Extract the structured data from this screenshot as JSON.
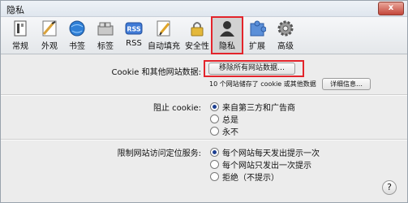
{
  "window": {
    "title": "隐私",
    "close_glyph": "x"
  },
  "toolbar": {
    "items": [
      {
        "label": "常规",
        "icon": "general-icon"
      },
      {
        "label": "外观",
        "icon": "appearance-icon"
      },
      {
        "label": "书签",
        "icon": "bookmarks-globe-icon"
      },
      {
        "label": "标签",
        "icon": "tabs-icon"
      },
      {
        "label": "RSS",
        "icon": "rss-icon",
        "text": "RSS"
      },
      {
        "label": "自动填充",
        "icon": "autofill-pencil-icon"
      },
      {
        "label": "安全性",
        "icon": "security-lock-icon"
      },
      {
        "label": "隐私",
        "icon": "privacy-person-icon"
      },
      {
        "label": "扩展",
        "icon": "extensions-puzzle-icon"
      },
      {
        "label": "高级",
        "icon": "advanced-gear-icon"
      }
    ],
    "active": "隐私"
  },
  "cookies": {
    "label": "Cookie 和其他网站数据:",
    "remove_all_button": "移除所有网站数据…",
    "info_text": "10 个网站储存了 cookie 或其他数据",
    "details_button": "详细信息…"
  },
  "block_cookies": {
    "label": "阻止 cookie:",
    "options": [
      "来自第三方和广告商",
      "总是",
      "永不"
    ],
    "selected": 0
  },
  "location": {
    "label": "限制网站访问定位服务:",
    "options": [
      "每个网站每天发出提示一次",
      "每个网站只发出一次提示",
      "拒绝（不提示）"
    ],
    "selected": 0
  },
  "help": {
    "glyph": "?"
  },
  "colors": {
    "highlight": "#e3242b",
    "radio_dot": "#1d3f91"
  }
}
